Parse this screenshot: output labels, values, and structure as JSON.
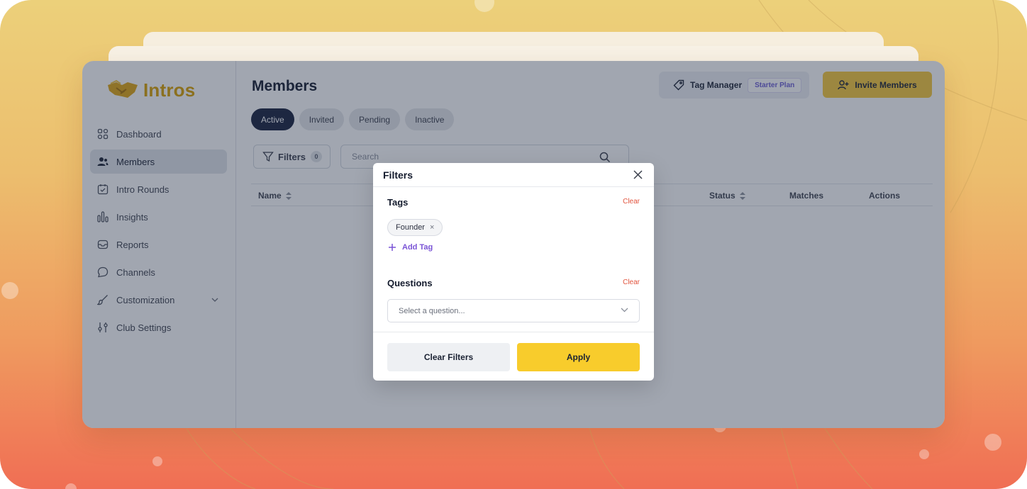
{
  "brand": {
    "name": "Intros",
    "logo_icon": "handshake-icon",
    "color": "#d9a100"
  },
  "sidebar": {
    "items": [
      {
        "label": "Dashboard",
        "icon": "grid-icon"
      },
      {
        "label": "Members",
        "icon": "users-icon",
        "active": true
      },
      {
        "label": "Intro Rounds",
        "icon": "calendar-icon"
      },
      {
        "label": "Insights",
        "icon": "bar-chart-icon"
      },
      {
        "label": "Reports",
        "icon": "inbox-icon"
      },
      {
        "label": "Channels",
        "icon": "chat-icon"
      },
      {
        "label": "Customization",
        "icon": "brush-icon",
        "expandable": true
      },
      {
        "label": "Club Settings",
        "icon": "sliders-icon"
      }
    ]
  },
  "header": {
    "title": "Members",
    "tag_manager_label": "Tag Manager",
    "plan_badge": "Starter Plan",
    "invite_label": "Invite Members"
  },
  "tabs": [
    {
      "label": "Active",
      "active": true
    },
    {
      "label": "Invited"
    },
    {
      "label": "Pending"
    },
    {
      "label": "Inactive"
    }
  ],
  "toolbar": {
    "filters_label": "Filters",
    "filters_count": "0",
    "search_placeholder": "Search"
  },
  "table": {
    "columns": [
      {
        "label": "Name",
        "sortable": true
      },
      {
        "label": "Status",
        "sortable": true
      },
      {
        "label": "Matches"
      },
      {
        "label": "Actions"
      }
    ]
  },
  "modal": {
    "title": "Filters",
    "tags_section": {
      "title": "Tags",
      "clear_label": "Clear",
      "chips": [
        "Founder"
      ],
      "chip_remove": "×",
      "add_label": "Add Tag"
    },
    "questions_section": {
      "title": "Questions",
      "clear_label": "Clear",
      "select_placeholder": "Select a question..."
    },
    "clear_filters_label": "Clear Filters",
    "apply_label": "Apply"
  },
  "colors": {
    "accent_yellow": "#f8cc2c",
    "dark_navy": "#17213d",
    "link_purple": "#7a54d6",
    "clear_red": "#e2543e"
  }
}
